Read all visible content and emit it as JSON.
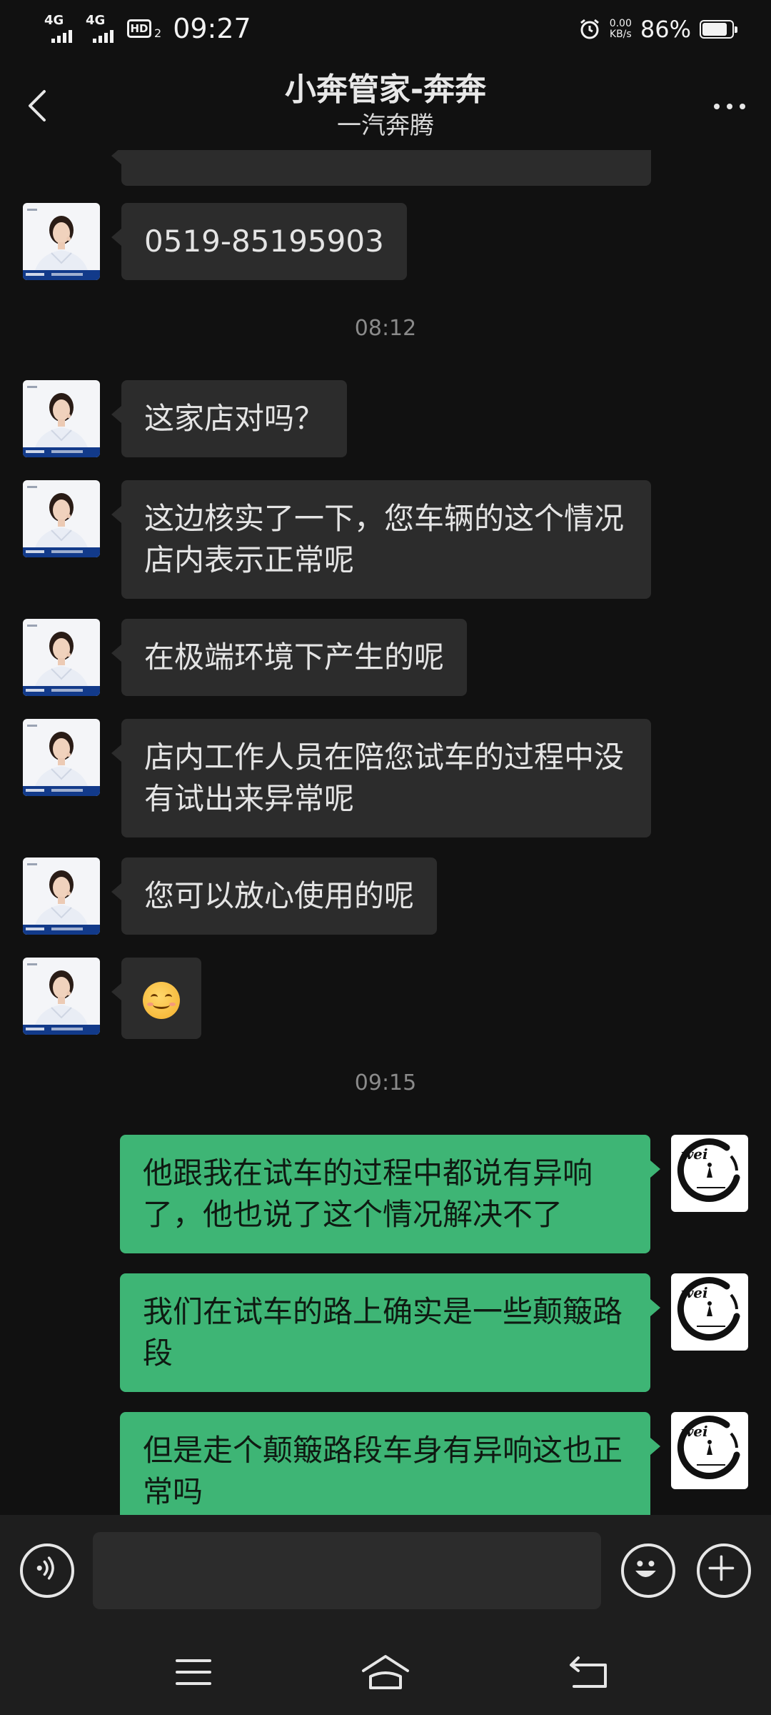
{
  "status_bar": {
    "network1": "4G",
    "network2": "4G",
    "hd": "HD",
    "hd_sub": "2",
    "time": "09:27",
    "speed_value": "0.00",
    "speed_unit": "KB/s",
    "battery": "86%",
    "battery_level": 0.86
  },
  "header": {
    "title": "小奔管家-奔奔",
    "subtitle": "一汽奔腾"
  },
  "messages": {
    "m0": "0519-85195903",
    "t1": "08:12",
    "m1": "这家店对吗？",
    "m2": "这边核实了一下，您车辆的这个情况店内表示正常呢",
    "m3": "在极端环境下产生的呢",
    "m4": "店内工作人员在陪您试车的过程中没有试出来异常呢",
    "m5": "您可以放心使用的呢",
    "t2": "09:15",
    "m7": "他跟我在试车的过程中都说有异响了，他也说了这个情况解决不了",
    "m8": "我们在试车的路上确实是一些颠簸路段",
    "m9": "但是走个颠簸路段车身有异响这也正常吗",
    "avatar_logo_text": "wei"
  },
  "input": {
    "value": ""
  },
  "colors": {
    "background": "#111111",
    "incoming_bubble": "#2c2c2c",
    "outgoing_bubble": "#3eb575",
    "phone_link": "#8fa8d6"
  }
}
